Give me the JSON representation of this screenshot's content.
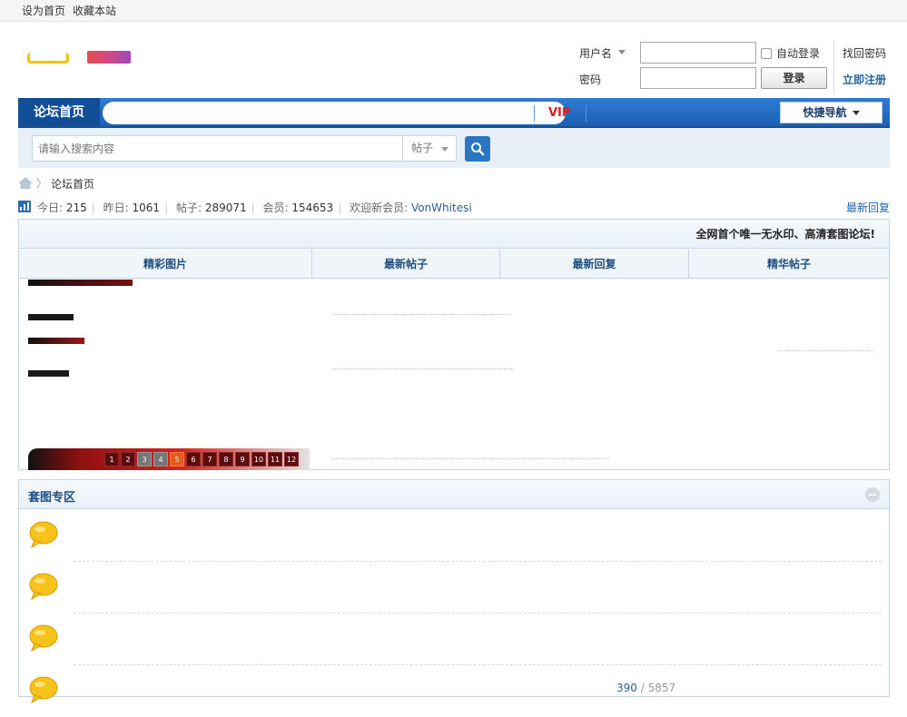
{
  "topbar": {
    "set_home": "设为首页",
    "bookmark": "收藏本站"
  },
  "login": {
    "username_label": "用户名",
    "password_label": "密码",
    "remember_label": "自动登录",
    "login_button": "登录",
    "forgot_password": "找回密码",
    "register": "立即注册"
  },
  "nav": {
    "home": "论坛首页",
    "vip": "VIP",
    "quick_nav": "快捷导航"
  },
  "search": {
    "placeholder": "请输入搜索内容",
    "type_selected": "帖子"
  },
  "breadcrumb": {
    "current": "论坛首页"
  },
  "stats": {
    "today_label": "今日:",
    "today": "215",
    "yesterday_label": "昨日:",
    "yesterday": "1061",
    "posts_label": "帖子:",
    "posts": "289071",
    "members_label": "会员:",
    "members": "154653",
    "welcome_label": "欢迎新会员:",
    "newest_member": "VonWhitesi",
    "latest_replies": "最新回复"
  },
  "panel": {
    "slogan": "全网首个唯一无水印、高清套图论坛!",
    "columns": [
      "精彩图片",
      "最新帖子",
      "最新回复",
      "精华帖子"
    ],
    "slide_pages": [
      "1",
      "2",
      "3",
      "4",
      "5",
      "6",
      "7",
      "8",
      "9",
      "10",
      "11",
      "12"
    ],
    "slide_active_index": 4
  },
  "section": {
    "title": "套图专区",
    "forum_count": 4,
    "today_threads": "390",
    "count_sep": "/",
    "total_posts": "5857"
  },
  "colors": {
    "nav_blue": "#1b61b6",
    "link_blue": "#2366a8",
    "vip_red": "#e81a1a",
    "bubble_yellow": "#f7c31b"
  },
  "icons": [
    "home-icon",
    "stats-bar-icon",
    "search-icon",
    "collapse-icon",
    "forum-bubble-icon",
    "dropdown-caret-icon"
  ]
}
